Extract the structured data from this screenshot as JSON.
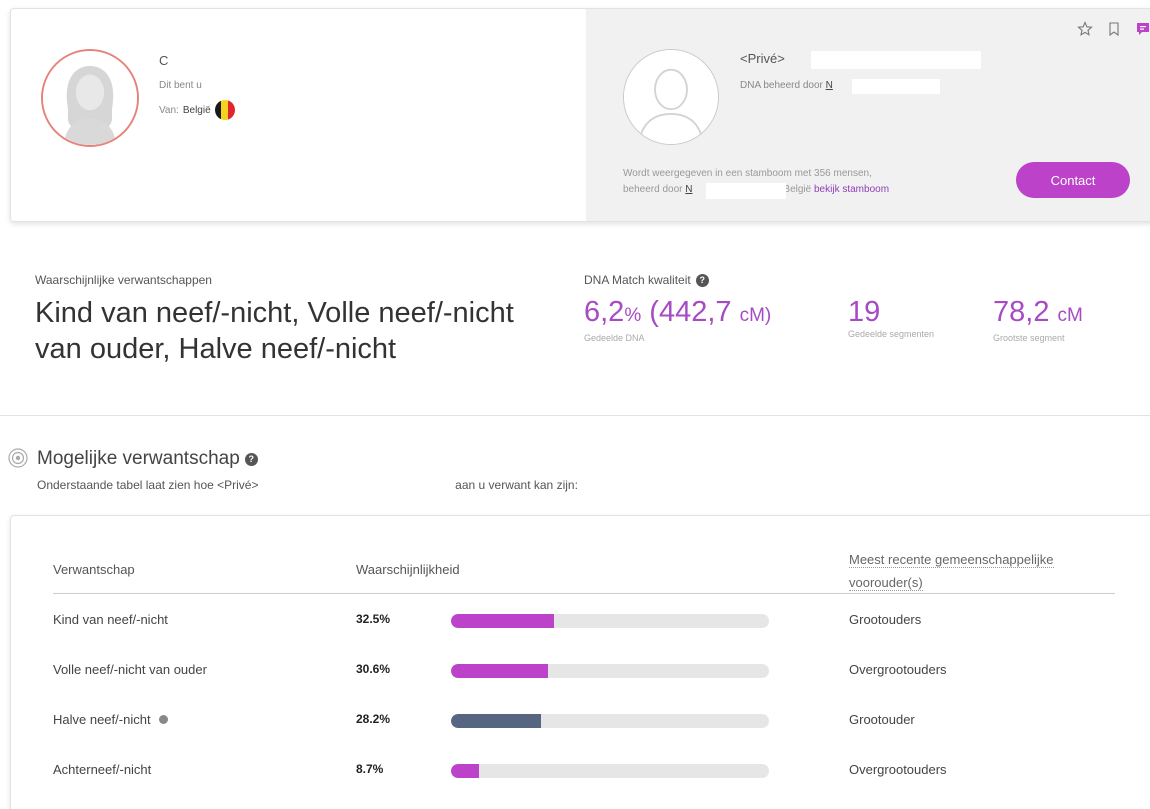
{
  "self": {
    "name": "C",
    "subtitle": "Dit bent u",
    "from_label": "Van:",
    "country": "België"
  },
  "match": {
    "name": "<Privé>",
    "managed_by": "DNA beheerd door",
    "managed_by_name": "N",
    "tree_info_line1": "Wordt weergegeven in een stamboom met 356 mensen,",
    "tree_info_prefix": "beheerd door",
    "tree_info_owner": "N",
    "tree_info_country": "uit België",
    "tree_link": "bekijk stamboom",
    "contact_label": "Contact"
  },
  "icons": {
    "star": "star-icon",
    "bookmark": "bookmark-icon",
    "chat": "chat-icon",
    "help": "help-icon",
    "target": "target-icon",
    "info": "info-icon",
    "flag": "belgium-flag-icon"
  },
  "relationship": {
    "label": "Waarschijnlijke verwantschappen",
    "title": "Kind van neef/-nicht, Volle neef/-nicht van ouder, Halve neef/-nicht"
  },
  "quality": {
    "label": "DNA Match kwaliteit",
    "help": "?",
    "shared_pct": "6,2",
    "pct_unit": "%",
    "shared_cm": "(442,7",
    "cm_unit": "cM)",
    "shared_caption": "Gedeelde DNA",
    "segments": "19",
    "segments_caption": "Gedeelde segmenten",
    "largest": "78,2",
    "largest_unit": "cM",
    "largest_caption": "Grootste segment"
  },
  "possible": {
    "title": "Mogelijke verwantschap",
    "help": "?",
    "subtitle_before": "Onderstaande tabel laat zien hoe <Privé>",
    "subtitle_after": "aan u verwant kan zijn:"
  },
  "table": {
    "col_relationship": "Verwantschap",
    "col_probability": "Waarschijnlijkheid",
    "col_ancestor_line1": "Meest recente gemeenschappelijke",
    "col_ancestor_line2": "voorouder(s)",
    "rows": [
      {
        "relationship": "Kind van neef/-nicht",
        "probability": "32.5%",
        "value": 32.5,
        "ancestor": "Grootouders",
        "color": "#bb42c9"
      },
      {
        "relationship": "Volle neef/-nicht van ouder",
        "probability": "30.6%",
        "value": 30.6,
        "ancestor": "Overgrootouders",
        "color": "#bb42c9"
      },
      {
        "relationship": "Halve neef/-nicht",
        "probability": "28.2%",
        "value": 28.2,
        "ancestor": "Grootouder",
        "color": "#566681"
      },
      {
        "relationship": "Achterneef/-nicht",
        "probability": "8.7%",
        "value": 8.7,
        "ancestor": "Overgrootouders",
        "color": "#bb42c9"
      }
    ]
  }
}
